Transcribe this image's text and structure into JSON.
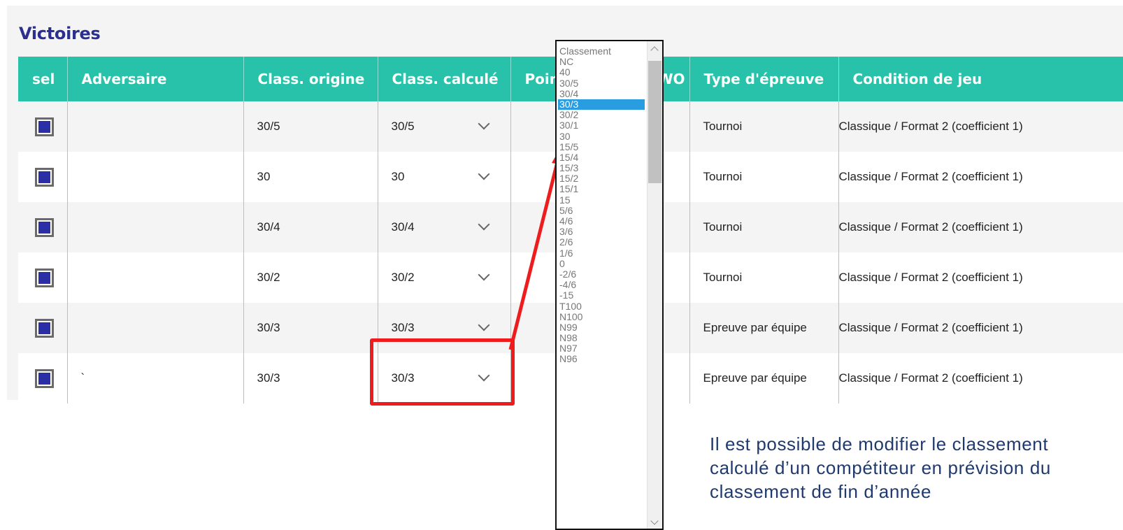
{
  "section": {
    "title": "Victoires"
  },
  "table": {
    "headers": [
      "sel",
      "Adversaire",
      "Class. origine",
      "Class. calculé",
      "Points",
      "WO",
      "Type d'épreuve",
      "Condition de jeu"
    ],
    "rows": [
      {
        "adversaire": "",
        "origine": "30/5",
        "calcule": "30/5",
        "points": "",
        "wo": "",
        "type": "Tournoi",
        "condition": "Classique / Format 2 (coefficient 1)"
      },
      {
        "adversaire": "",
        "origine": "30",
        "calcule": "30",
        "points": "",
        "wo": "",
        "type": "Tournoi",
        "condition": "Classique / Format 2 (coefficient 1)"
      },
      {
        "adversaire": "",
        "origine": "30/4",
        "calcule": "30/4",
        "points": "",
        "wo": "",
        "type": "Tournoi",
        "condition": "Classique / Format 2 (coefficient 1)"
      },
      {
        "adversaire": "",
        "origine": "30/2",
        "calcule": "30/2",
        "points": "",
        "wo": "",
        "type": "Tournoi",
        "condition": "Classique / Format 2 (coefficient 1)"
      },
      {
        "adversaire": "",
        "origine": "30/3",
        "calcule": "30/3",
        "points": "",
        "wo": "",
        "type": "Epreuve par équipe",
        "condition": "Classique / Format 2 (coefficient 1)"
      },
      {
        "adversaire": "`",
        "origine": "30/3",
        "calcule": "30/3",
        "points": "",
        "wo": "",
        "type": "Epreuve par équipe",
        "condition": "Classique / Format 2 (coefficient 1)"
      }
    ]
  },
  "dropdown": {
    "selected": "30/3",
    "options": [
      "Classement",
      "NC",
      "40",
      "30/5",
      "30/4",
      "30/3",
      "30/2",
      "30/1",
      "30",
      "15/5",
      "15/4",
      "15/3",
      "15/2",
      "15/1",
      "15",
      "5/6",
      "4/6",
      "3/6",
      "2/6",
      "1/6",
      "0",
      "-2/6",
      "-4/6",
      "-15",
      "T100",
      "N100",
      "N99",
      "N98",
      "N97",
      "N96"
    ]
  },
  "annotation": {
    "lines": [
      "Il est possible de modifier le classement",
      "calculé d’un compétiteur en prévision du",
      "classement de fin d’année"
    ]
  },
  "colors": {
    "header_bg": "#28c2aa",
    "title": "#2b2f8f",
    "highlight": "#ee1c1c",
    "selected_option": "#2a9de0",
    "note_text": "#1f3a6e"
  }
}
